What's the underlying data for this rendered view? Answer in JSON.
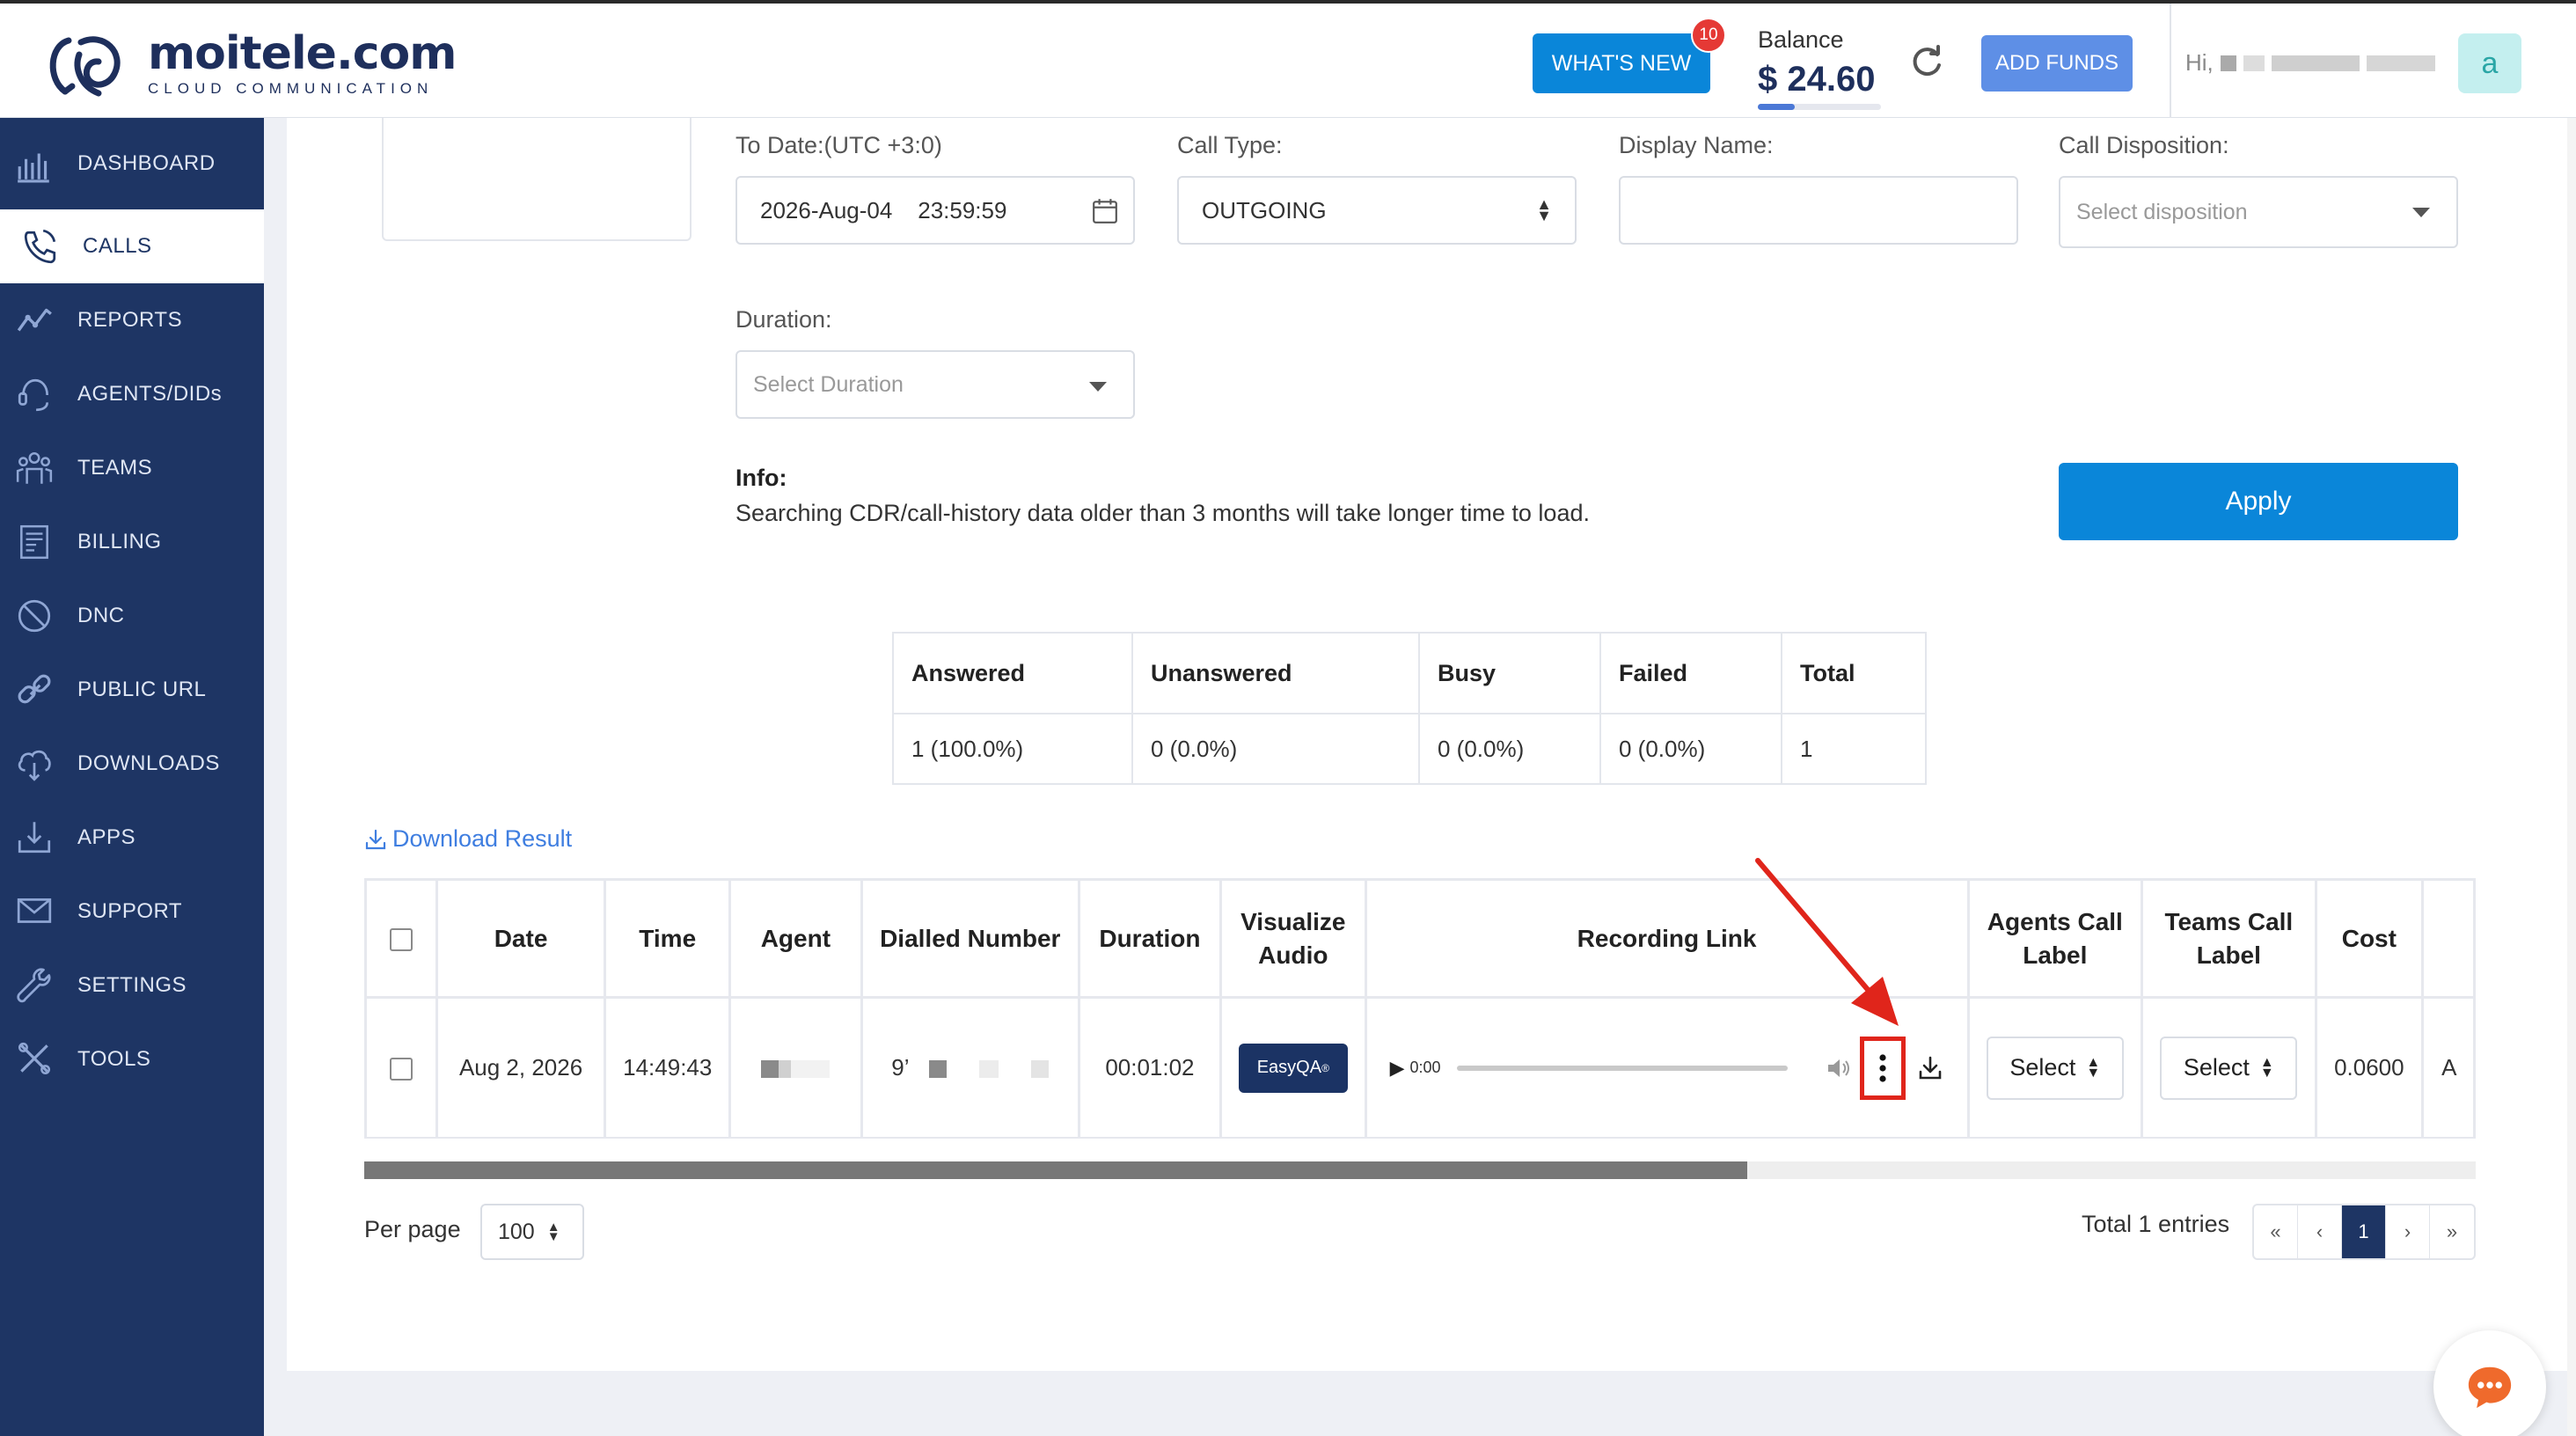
{
  "brand": {
    "name": "moitele.com",
    "tagline": "CLOUD COMMUNICATION",
    "color": "#1e2f5c"
  },
  "header": {
    "whats_new_label": "WHAT'S NEW",
    "whats_new_badge": "10",
    "balance_label": "Balance",
    "balance_value": "$ 24.60",
    "add_funds_label": "ADD FUNDS",
    "greeting": "Hi,",
    "avatar_initial": "a"
  },
  "sidebar": {
    "items": [
      {
        "label": "DASHBOARD",
        "icon": "dashboard-icon"
      },
      {
        "label": "CALLS",
        "icon": "calls-icon",
        "active": true
      },
      {
        "label": "REPORTS",
        "icon": "reports-icon"
      },
      {
        "label": "AGENTS/DIDs",
        "icon": "agents-icon"
      },
      {
        "label": "TEAMS",
        "icon": "teams-icon"
      },
      {
        "label": "BILLING",
        "icon": "billing-icon"
      },
      {
        "label": "DNC",
        "icon": "dnc-icon"
      },
      {
        "label": "PUBLIC URL",
        "icon": "link-icon"
      },
      {
        "label": "DOWNLOADS",
        "icon": "cloud-download-icon"
      },
      {
        "label": "APPS",
        "icon": "apps-icon"
      },
      {
        "label": "SUPPORT",
        "icon": "mail-icon"
      },
      {
        "label": "SETTINGS",
        "icon": "wrench-icon"
      },
      {
        "label": "TOOLS",
        "icon": "tools-icon"
      }
    ]
  },
  "filters": {
    "to_date": {
      "label": "To Date:(UTC +3:0)",
      "value": "2026-Aug-04    23:59:59"
    },
    "call_type": {
      "label": "Call Type:",
      "value": "OUTGOING"
    },
    "display_name": {
      "label": "Display Name:",
      "value": ""
    },
    "call_disposition": {
      "label": "Call Disposition:",
      "placeholder": "Select disposition"
    },
    "duration": {
      "label": "Duration:",
      "placeholder": "Select Duration"
    },
    "apply_label": "Apply"
  },
  "info": {
    "heading": "Info:",
    "text": "Searching CDR/call-history data older than 3 months will take longer time to load."
  },
  "summary": {
    "headers": [
      "Answered",
      "Unanswered",
      "Busy",
      "Failed",
      "Total"
    ],
    "values": [
      "1 (100.0%)",
      "0 (0.0%)",
      "0 (0.0%)",
      "0 (0.0%)",
      "1"
    ]
  },
  "download_result_label": "Download Result",
  "calls_table": {
    "headers": [
      "Date",
      "Time",
      "Agent",
      "Dialled Number",
      "Duration",
      "Visualize Audio",
      "Recording Link",
      "Agents Call Label",
      "Teams Call Label",
      "Cost"
    ],
    "rows": [
      {
        "date": "Aug 2, 2026",
        "time": "14:49:43",
        "dialled_prefix": "9’",
        "duration": "00:01:02",
        "visualize_label": "EasyQA",
        "visualize_mark": "®",
        "player_time": "0:00",
        "agents_label": "Select",
        "teams_label": "Select",
        "cost": "0.0600",
        "next_col": "A"
      }
    ]
  },
  "pagination": {
    "per_page_label": "Per page",
    "per_page_value": "100",
    "total_text": "Total 1 entries",
    "first": "«",
    "prev": "‹",
    "current": "1",
    "next": "›",
    "last": "»"
  },
  "colors": {
    "sidebar": "#1e3564",
    "primary": "#0a86d9",
    "annotation": "#e0251b"
  }
}
